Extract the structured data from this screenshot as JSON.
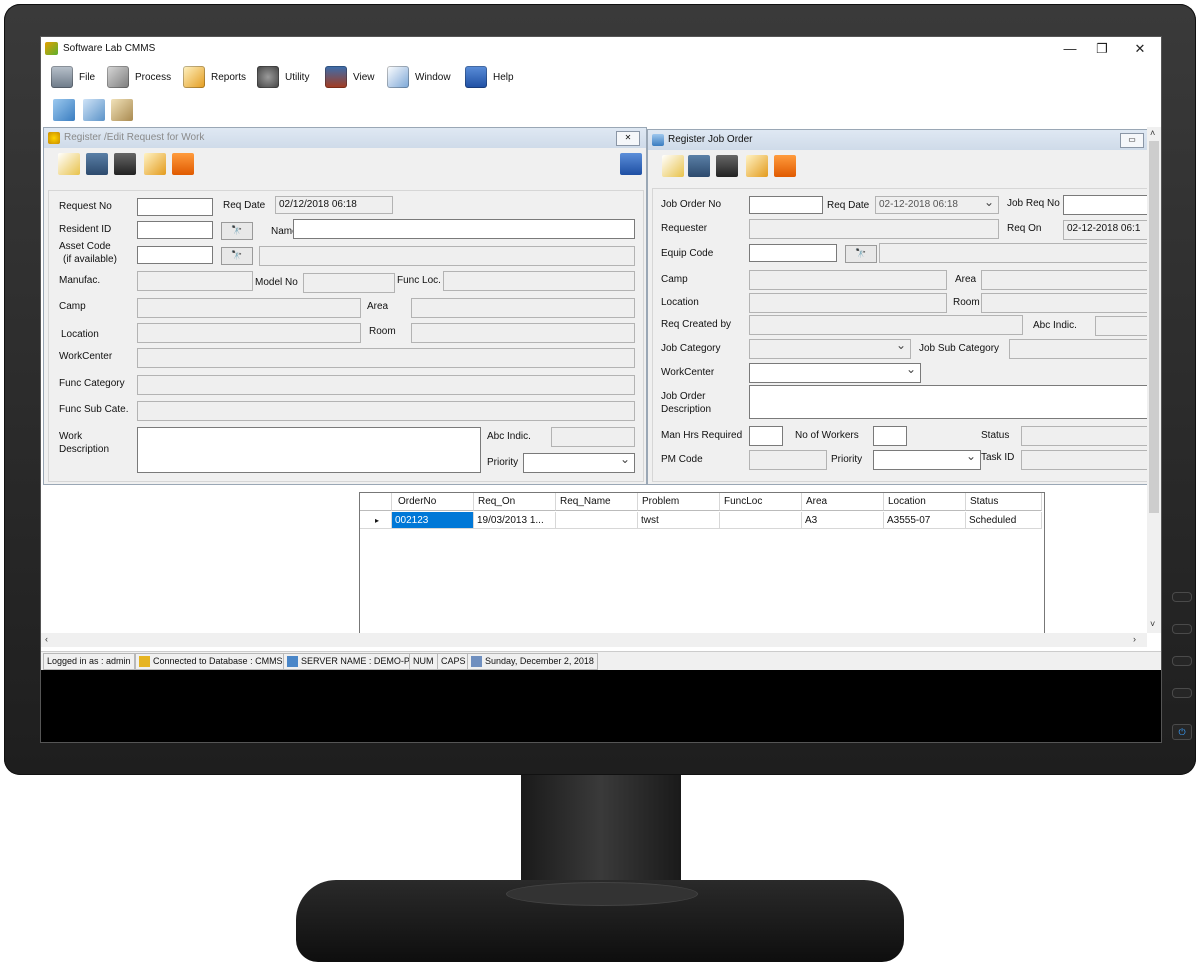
{
  "app": {
    "title": "Software Lab CMMS",
    "window_controls": [
      "—",
      "❐",
      "✕"
    ],
    "menu": [
      {
        "label": "File",
        "icon": "file-icon"
      },
      {
        "label": "Process",
        "icon": "process-icon"
      },
      {
        "label": "Reports",
        "icon": "reports-icon"
      },
      {
        "label": "Utility",
        "icon": "utility-icon"
      },
      {
        "label": "View",
        "icon": "view-icon"
      },
      {
        "label": "Window",
        "icon": "window-icon"
      },
      {
        "label": "Help",
        "icon": "help-icon"
      }
    ],
    "toolbar": [
      "cut-icon",
      "copy-icon",
      "paste-icon"
    ]
  },
  "request_window": {
    "title": "Register /Edit Request for Work",
    "fields": {
      "request_no_label": "Request No",
      "req_date_label": "Req Date",
      "req_date_value": "02/12/2018 06:18",
      "resident_id_label": "Resident ID",
      "name_label": "Name",
      "asset_code_label": "Asset Code",
      "asset_code_sub": "(if available)",
      "manufac_label": "Manufac.",
      "model_no_label": "Model No",
      "func_loc_label": "Func Loc.",
      "camp_label": "Camp",
      "area_label": "Area",
      "location_label": "Location",
      "room_label": "Room",
      "workcenter_label": "WorkCenter",
      "func_category_label": "Func Category",
      "func_sub_cate_label": "Func Sub Cate.",
      "work_label": "Work",
      "description_label": "Description",
      "abc_indic_label": "Abc Indic.",
      "priority_label": "Priority"
    },
    "search_button": "🔭"
  },
  "job_window": {
    "title": "Register Job Order",
    "fields": {
      "job_order_no_label": "Job Order No",
      "req_date_label": "Req Date",
      "req_date_value": "02-12-2018 06:18",
      "job_req_no_label": "Job Req No",
      "requester_label": "Requester",
      "req_on_label": "Req On",
      "req_on_value": "02-12-2018 06:1",
      "equip_code_label": "Equip Code",
      "camp_label": "Camp",
      "area_label": "Area",
      "location_label": "Location",
      "room_label": "Room",
      "req_created_by_label": "Req Created by",
      "abc_indic_label": "Abc Indic.",
      "job_category_label": "Job Category",
      "job_sub_category_label": "Job Sub Category",
      "workcenter_label": "WorkCenter",
      "job_order_label": "Job Order",
      "description_label": "Description",
      "man_hrs_label": "Man Hrs Required",
      "no_workers_label": "No of Workers",
      "status_label": "Status",
      "pm_code_label": "PM Code",
      "priority_label": "Priority",
      "task_id_label": "Task ID"
    }
  },
  "grid": {
    "columns": [
      "OrderNo",
      "Req_On",
      "Req_Name",
      "Problem",
      "FuncLoc",
      "Area",
      "Location",
      "Status"
    ],
    "rows": [
      [
        "002123",
        "19/03/2013 1...",
        "",
        "twst",
        "",
        "A3",
        "A3555-07",
        "Scheduled"
      ]
    ],
    "row_marker": "▸"
  },
  "statusbar": {
    "logged_in": "Logged in as : admin",
    "database": "Connected to Database : CMMS",
    "server": "SERVER NAME : DEMO-PC",
    "num": "NUM",
    "caps": "CAPS",
    "date": "Sunday, December 2, 2018"
  },
  "colors": {
    "selection": "#0078d7",
    "title_gradient": "#cfdbe9",
    "window_bg": "#f0f0f0"
  }
}
